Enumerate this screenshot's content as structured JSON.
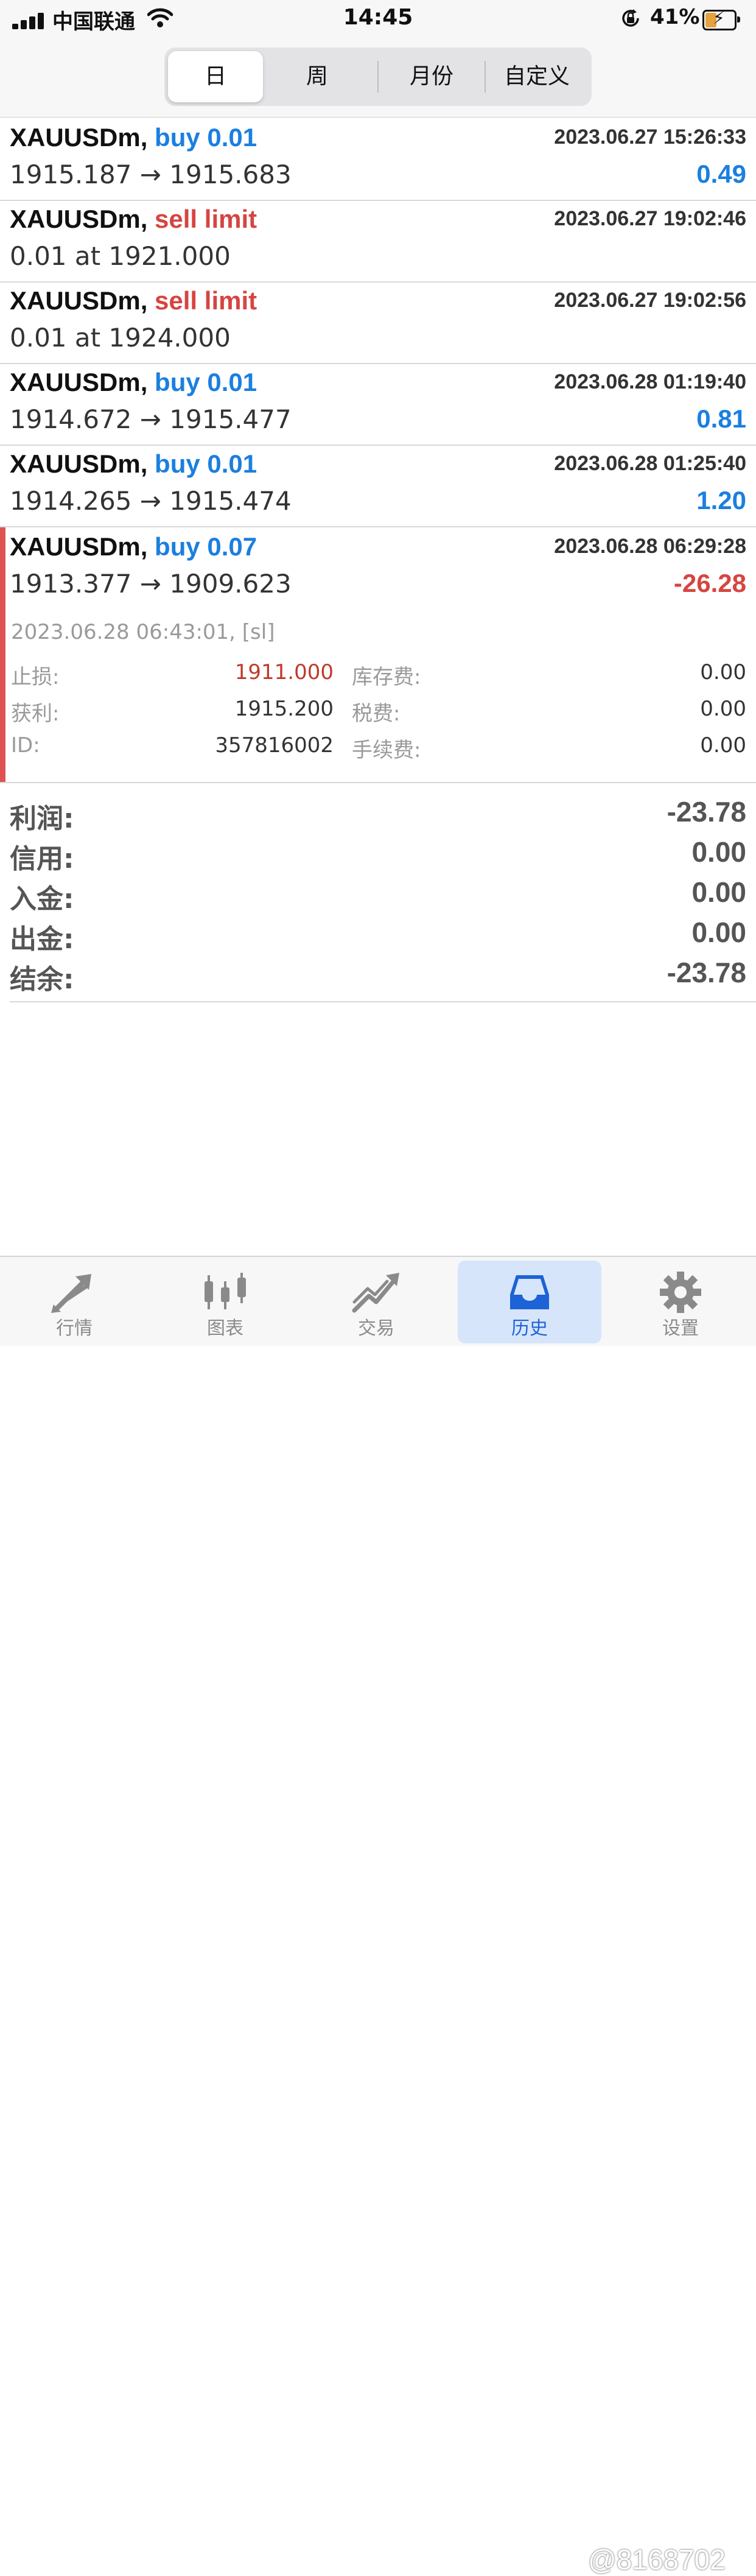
{
  "status_bar": {
    "carrier": "中国联通",
    "time": "14:45",
    "battery": "41%",
    "battery_level": 0.41,
    "icons": [
      "signal-icon",
      "wifi-icon",
      "orientation-lock-icon",
      "battery-icon"
    ]
  },
  "period_tabs": [
    {
      "label": "日",
      "active": true
    },
    {
      "label": "周",
      "active": false
    },
    {
      "label": "月份",
      "active": false
    },
    {
      "label": "自定义",
      "active": false
    }
  ],
  "trades": [
    {
      "symbol": "XAUUSDm,",
      "action": "buy 0.01",
      "side": "buy",
      "datetime": "2023.06.27 15:26:33",
      "prices": "1915.187 → 1915.683",
      "profit": "0.49"
    },
    {
      "symbol": "XAUUSDm,",
      "action": "sell limit",
      "side": "sell",
      "datetime": "2023.06.27 19:02:46",
      "prices": "0.01 at 1921.000",
      "profit": ""
    },
    {
      "symbol": "XAUUSDm,",
      "action": "sell limit",
      "side": "sell",
      "datetime": "2023.06.27 19:02:56",
      "prices": "0.01 at 1924.000",
      "profit": ""
    },
    {
      "symbol": "XAUUSDm,",
      "action": "buy 0.01",
      "side": "buy",
      "datetime": "2023.06.28 01:19:40",
      "prices": "1914.672 → 1915.477",
      "profit": "0.81"
    },
    {
      "symbol": "XAUUSDm,",
      "action": "buy 0.01",
      "side": "buy",
      "datetime": "2023.06.28 01:25:40",
      "prices": "1914.265 → 1915.474",
      "profit": "1.20"
    },
    {
      "symbol": "XAUUSDm,",
      "action": "buy 0.07",
      "side": "buy",
      "datetime": "2023.06.28 06:29:28",
      "prices": "1913.377 → 1909.623",
      "profit": "-26.28"
    }
  ],
  "expanded_details": {
    "close_info": "2023.06.28 06:43:01, [sl]",
    "stop_loss_label": "止损:",
    "stop_loss_value": "1911.000",
    "take_profit_label": "获利:",
    "take_profit_value": "1915.200",
    "id_label": "ID:",
    "id_value": "357816002",
    "swap_label": "库存费:",
    "swap_value": "0.00",
    "tax_label": "税费:",
    "tax_value": "0.00",
    "commission_label": "手续费:",
    "commission_value": "0.00"
  },
  "summary": [
    {
      "label": "利润:",
      "value": "-23.78"
    },
    {
      "label": "信用:",
      "value": "0.00"
    },
    {
      "label": "入金:",
      "value": "0.00"
    },
    {
      "label": "出金:",
      "value": "0.00"
    },
    {
      "label": "结余:",
      "value": "-23.78"
    }
  ],
  "tab_bar": [
    {
      "label": "行情",
      "icon": "quotes-arrows-icon",
      "active": false
    },
    {
      "label": "图表",
      "icon": "candlestick-chart-icon",
      "active": false
    },
    {
      "label": "交易",
      "icon": "trade-trend-icon",
      "active": false
    },
    {
      "label": "历史",
      "icon": "history-inbox-icon",
      "active": true
    },
    {
      "label": "设置",
      "icon": "gear-icon",
      "active": false
    }
  ],
  "watermark": "@8168702",
  "colors": {
    "buy": "#1b7fe0",
    "sell": "#d64541",
    "active_tab": "#1b63d6",
    "stop_loss_bar": "#e05252"
  }
}
